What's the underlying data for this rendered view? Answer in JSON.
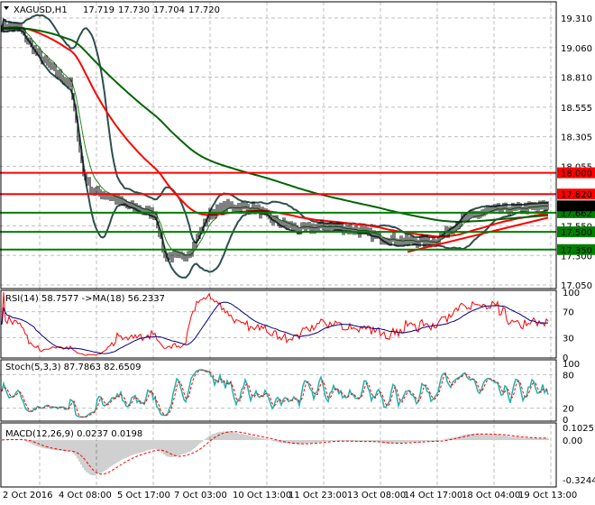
{
  "chart_data": {
    "type": "line",
    "title": "XAGUSD,H1",
    "ohlc": {
      "open": "17.719",
      "high": "17.730",
      "low": "17.704",
      "close": "17.720"
    },
    "price_ticks": [
      "19.310",
      "19.060",
      "18.810",
      "18.555",
      "18.305",
      "18.055",
      "17.550",
      "17.300",
      "17.050"
    ],
    "ylim": [
      17.05,
      19.31
    ],
    "current_price": {
      "label": "17.720",
      "value": 17.72
    },
    "levels": [
      {
        "label": "18.000",
        "value": 18.0,
        "color": "#ff0000"
      },
      {
        "label": "17.820",
        "value": 17.82,
        "color": "#ff0000"
      },
      {
        "label": "17.662",
        "value": 17.662,
        "color": "#008000"
      },
      {
        "label": "17.500",
        "value": 17.5,
        "color": "#008000"
      },
      {
        "label": "17.350",
        "value": 17.35,
        "color": "#008000"
      }
    ],
    "close_keypoints": [
      [
        0,
        19.25
      ],
      [
        10,
        19.22
      ],
      [
        15,
        19.1
      ],
      [
        20,
        19.0
      ],
      [
        30,
        18.85
      ],
      [
        38,
        18.75
      ],
      [
        45,
        18.0
      ],
      [
        50,
        17.85
      ],
      [
        60,
        17.8
      ],
      [
        70,
        17.72
      ],
      [
        85,
        17.65
      ],
      [
        90,
        17.3
      ],
      [
        100,
        17.28
      ],
      [
        105,
        17.35
      ],
      [
        115,
        17.65
      ],
      [
        125,
        17.72
      ],
      [
        140,
        17.7
      ],
      [
        150,
        17.6
      ],
      [
        165,
        17.52
      ],
      [
        180,
        17.55
      ],
      [
        195,
        17.52
      ],
      [
        210,
        17.45
      ],
      [
        225,
        17.42
      ],
      [
        240,
        17.42
      ],
      [
        255,
        17.6
      ],
      [
        270,
        17.68
      ],
      [
        290,
        17.7
      ],
      [
        303,
        17.72
      ]
    ],
    "time_labels": [
      "2 Oct 2016",
      "4 Oct 08:00",
      "5 Oct 17:00",
      "7 Oct 03:00",
      "10 Oct 13:00",
      "11 Oct 23:00",
      "13 Oct 08:00",
      "14 Oct 17:00",
      "18 Oct 04:00",
      "19 Oct 13:00"
    ],
    "rsi": {
      "label": "RSI(14) 58.7577  ->MA(18) 56.2337",
      "ticks": [
        "100",
        "70",
        "30",
        "0"
      ]
    },
    "stoch": {
      "label": "Stoch(5,3,3) 87.7863 82.6509",
      "ticks": [
        "100",
        "80",
        "20",
        "0"
      ]
    },
    "macd": {
      "label": "MACD(12,26,9) 0.0237 0.0198",
      "ticks": [
        "0.1025",
        "0.00",
        "-0.3244"
      ]
    },
    "colors": {
      "price": "#000000",
      "sma_slow": "#006400",
      "ema": "#ff0000",
      "bands": "#2f4f4f",
      "rsi": "#ff0000",
      "rsi_ma": "#000080",
      "stoch_main": "#20b2aa",
      "stoch_signal": "#ff0000"
    }
  }
}
